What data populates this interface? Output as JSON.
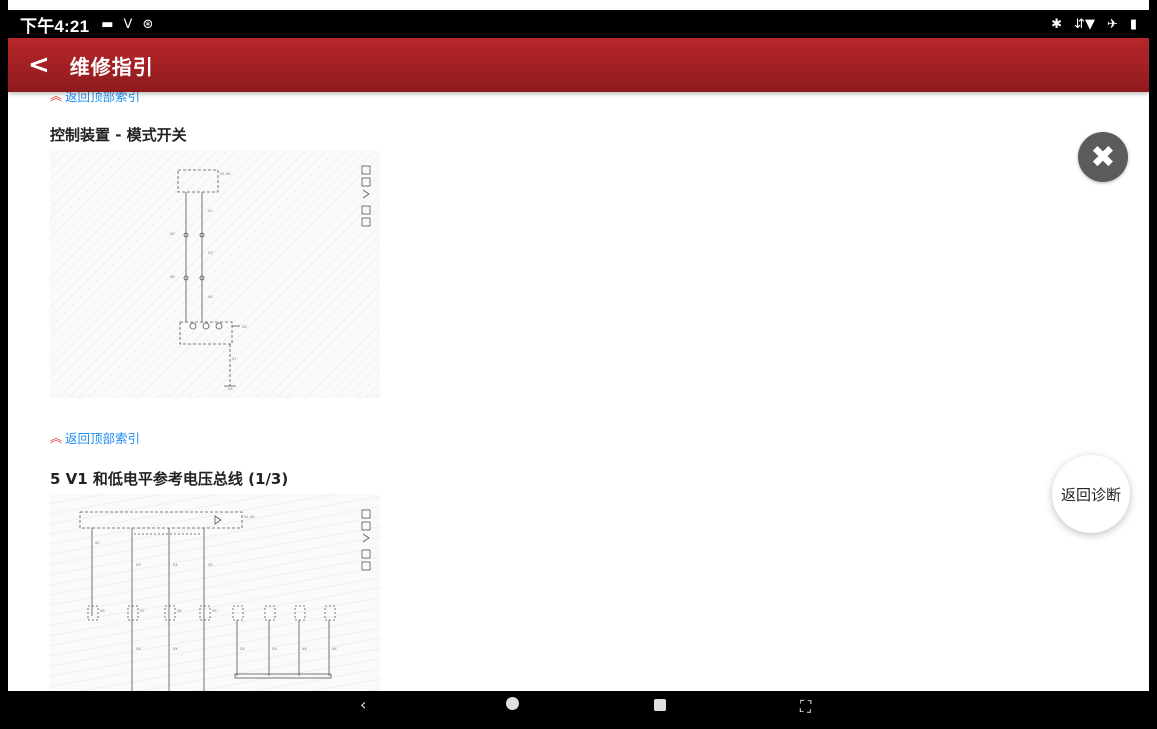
{
  "status_bar": {
    "time": "下午4:21",
    "left_icons": [
      "message-icon",
      "usb-icon",
      "sync-icon"
    ],
    "right_icons": [
      "bluetooth-icon",
      "wifi-icon",
      "airplane-icon",
      "battery-icon"
    ]
  },
  "app_bar": {
    "back_label": "<",
    "title": "维修指引",
    "color_top": "#b8272a",
    "color_bottom": "#8e1a1d"
  },
  "content": {
    "back_to_top_link": "返回顶部索引",
    "sections": [
      {
        "title": "控制装置 - 模式开关"
      },
      {
        "title": "5 V1 和低电平参考电压总线 (1/3)"
      }
    ]
  },
  "floating": {
    "close_icon": "close-icon",
    "return_diagnosis_label": "返回诊断"
  },
  "nav_bar": {
    "back": "‹",
    "buttons": [
      "back-icon",
      "home-icon",
      "recent-apps-icon",
      "screenshot-icon"
    ]
  }
}
